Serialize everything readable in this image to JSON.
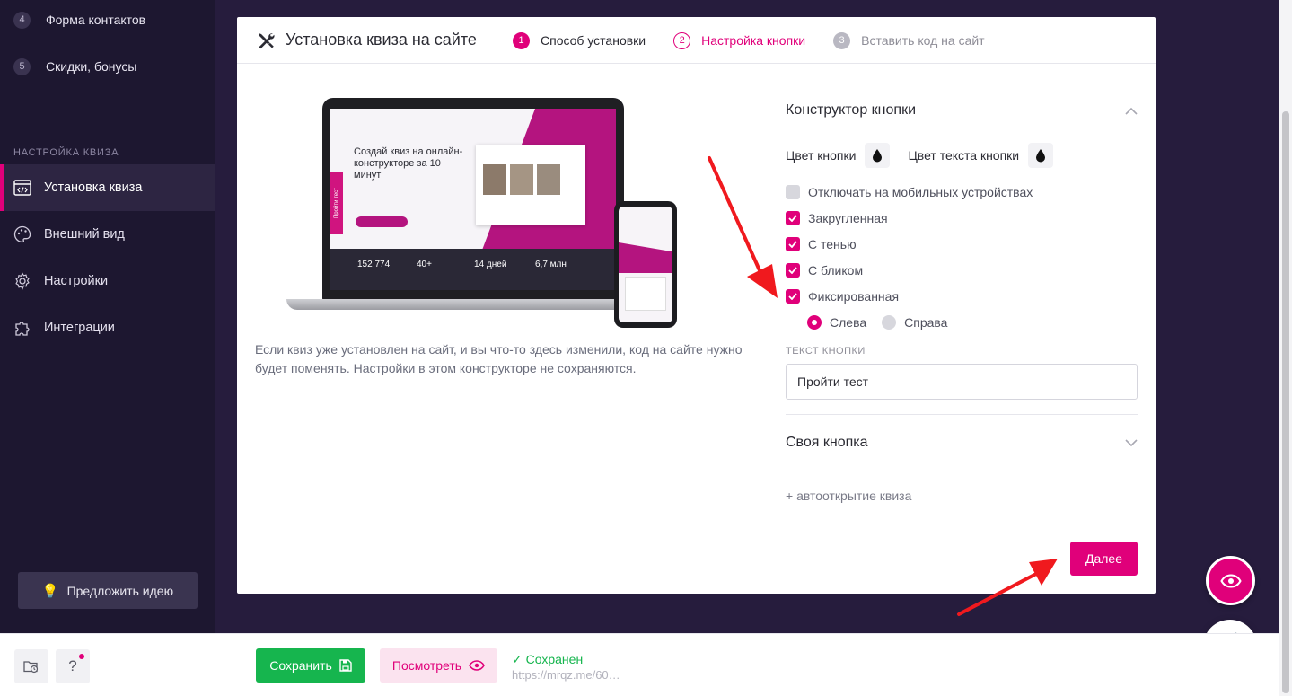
{
  "sidebar": {
    "steps": [
      {
        "num": "4",
        "label": "Форма контактов"
      },
      {
        "num": "5",
        "label": "Скидки, бонусы"
      }
    ],
    "section_title": "НАСТРОЙКА КВИЗА",
    "nav": [
      {
        "label": "Установка квиза",
        "icon": "code-window-icon",
        "active": true
      },
      {
        "label": "Внешний вид",
        "icon": "palette-icon",
        "active": false
      },
      {
        "label": "Настройки",
        "icon": "gear-icon",
        "active": false
      },
      {
        "label": "Интеграции",
        "icon": "puzzle-icon",
        "active": false
      }
    ],
    "idea_button": "Предложить идею"
  },
  "card": {
    "title": "Установка квиза на сайте",
    "steps": [
      {
        "num": "1",
        "label": "Способ установки"
      },
      {
        "num": "2",
        "label": "Настройка кнопки"
      },
      {
        "num": "3",
        "label": "Вставить код на сайт"
      }
    ],
    "hint": "Если квиз уже установлен на сайт, и вы что-то здесь изменили, код на сайте нужно будет поменять. Настройки в этом конструкторе не сохраняются."
  },
  "preview": {
    "laptop_headline": "Создай квиз на онлайн-конструкторе за 10 минут",
    "side_tab": "Пройти тест",
    "stats": [
      "152 774",
      "40+",
      "14 дней",
      "6,7 млн"
    ]
  },
  "constructor": {
    "title": "Конструктор кнопки",
    "button_color_label": "Цвет кнопки",
    "text_color_label": "Цвет текста кнопки",
    "options": [
      {
        "label": "Отключать на мобильных устройствах",
        "checked": false
      },
      {
        "label": "Закругленная",
        "checked": true
      },
      {
        "label": "С тенью",
        "checked": true
      },
      {
        "label": "С бликом",
        "checked": true
      },
      {
        "label": "Фиксированная",
        "checked": true
      }
    ],
    "position": [
      {
        "label": "Слева",
        "selected": true
      },
      {
        "label": "Справа",
        "selected": false
      }
    ],
    "text_label": "ТЕКСТ КНОПКИ",
    "text_value": "Пройти тест",
    "own_button": "Своя кнопка",
    "autoopen": "+ автооткрытие квиза",
    "next": "Далее"
  },
  "bottombar": {
    "help": "?",
    "save": "Сохранить",
    "view": "Посмотреть",
    "saved": "✓ Сохранен",
    "url": "https://mrqz.me/60…"
  },
  "colors": {
    "accent": "#e0007a",
    "success": "#16b54e",
    "sidebar": "#1d1730",
    "background": "#261c3d"
  }
}
